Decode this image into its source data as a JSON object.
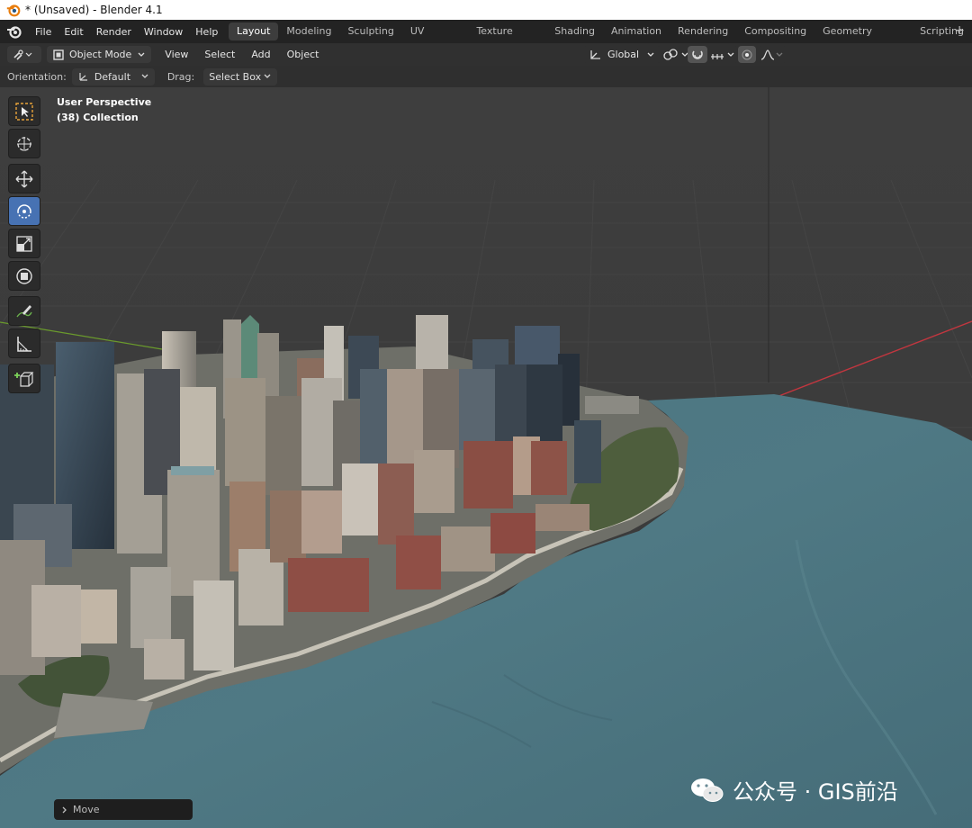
{
  "window": {
    "title": "* (Unsaved) - Blender 4.1"
  },
  "menu": [
    "File",
    "Edit",
    "Render",
    "Window",
    "Help"
  ],
  "workspaces": {
    "tabs": [
      "Layout",
      "Modeling",
      "Sculpting",
      "UV Editing",
      "Texture Paint",
      "Shading",
      "Animation",
      "Rendering",
      "Compositing",
      "Geometry Nodes",
      "Scripting"
    ],
    "active": "Layout",
    "add": "+"
  },
  "header": {
    "mode": "Object Mode",
    "menus": [
      "View",
      "Select",
      "Add",
      "Object"
    ],
    "transform_orientation": "Global"
  },
  "tool_settings": {
    "orientation_label": "Orientation:",
    "orientation_value": "Default",
    "drag_label": "Drag:",
    "drag_value": "Select Box"
  },
  "viewport": {
    "perspective": "User Perspective",
    "collection": "(38) Collection"
  },
  "last_operator": {
    "label": "Move"
  },
  "watermark": {
    "text": "公众号 · GIS前沿"
  },
  "colors": {
    "accent": "#4772b3",
    "water": "#4e7682",
    "background": "#3d3d3d",
    "x_axis": "#c2363f",
    "y_axis": "#6a9a2c"
  },
  "icons": [
    "blender-logo-icon",
    "select-box-icon",
    "cursor-icon",
    "move-icon",
    "rotate-icon",
    "scale-icon",
    "transform-icon",
    "annotate-icon",
    "measure-icon",
    "add-cube-icon",
    "wechat-icon"
  ]
}
